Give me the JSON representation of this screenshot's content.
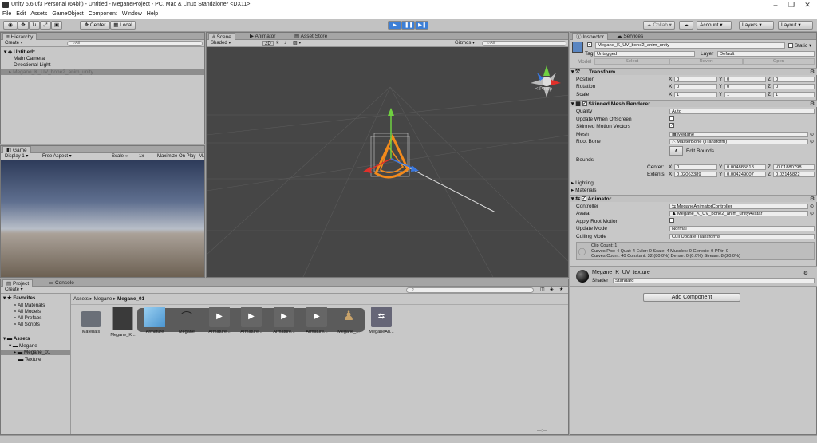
{
  "window": {
    "title": "Unity 5.6.0f3 Personal (64bit) - Untitled - MeganeProject - PC, Mac & Linux Standalone* <DX11>"
  },
  "menu": [
    "File",
    "Edit",
    "Assets",
    "GameObject",
    "Component",
    "Window",
    "Help"
  ],
  "toolbar": {
    "center": "Center",
    "local": "Local",
    "collab": "Collab",
    "account": "Account",
    "layers": "Layers",
    "layout": "Layout"
  },
  "hierarchy": {
    "tab": "Hierarchy",
    "create": "Create",
    "search": "All",
    "scene": "Untitled*",
    "items": [
      "Main Camera",
      "Directional Light",
      "Megane_K_UV_bone2_anim_unity"
    ]
  },
  "scene": {
    "tabs": [
      "Scene",
      "Animator",
      "Asset Store"
    ],
    "shaded": "Shaded",
    "mode2d": "2D",
    "gizmos": "Gizmos",
    "search": "All",
    "persp": "< Persp"
  },
  "game": {
    "tab": "Game",
    "display": "Display 1",
    "aspect": "Free Aspect",
    "scale": "Scale",
    "scale_val": "1x",
    "maximize": "Maximize On Play",
    "mute": "Mu"
  },
  "project": {
    "tabs": [
      "Project",
      "Console"
    ],
    "create": "Create",
    "favorites": {
      "label": "Favorites",
      "items": [
        "All Materials",
        "All Models",
        "All Prefabs",
        "All Scripts"
      ]
    },
    "assets": {
      "label": "Assets",
      "megane": "Megane",
      "megane01": "Megane_01",
      "texture": "Texture"
    },
    "breadcrumb": [
      "Assets",
      "Megane",
      "Megane_01"
    ],
    "files": [
      "Materials",
      "Megane_K...",
      "Armature",
      "Megane",
      "Armature...",
      "Armature...",
      "Armature...",
      "Armature...",
      "Megane_...",
      "MeganeAn..."
    ]
  },
  "inspector": {
    "tabs": [
      "Inspector",
      "Services"
    ],
    "object_name": "Megane_K_UV_bone2_anim_unity",
    "static": "Static",
    "tag_label": "Tag",
    "tag": "Untagged",
    "layer_label": "Layer",
    "layer": "Default",
    "model": "Model",
    "select": "Select",
    "revert": "Revert",
    "open": "Open",
    "transform": {
      "title": "Transform",
      "rows": [
        {
          "label": "Position",
          "x": "0",
          "y": "0",
          "z": "0"
        },
        {
          "label": "Rotation",
          "x": "0",
          "y": "0",
          "z": "0"
        },
        {
          "label": "Scale",
          "x": "1",
          "y": "1",
          "z": "1"
        }
      ]
    },
    "smr": {
      "title": "Skinned Mesh Renderer",
      "quality_label": "Quality",
      "quality": "Auto",
      "update_offscreen": "Update When Offscreen",
      "skinned_motion": "Skinned Motion Vectors",
      "mesh_label": "Mesh",
      "mesh": "Megane",
      "root_bone_label": "Root Bone",
      "root_bone": "MasterBone (Transform)",
      "edit_bounds": "Edit Bounds",
      "bounds": "Bounds",
      "center_label": "Center:",
      "center": {
        "x": "0",
        "y": "0.004885818",
        "z": "-0.01880798"
      },
      "extents_label": "Extents:",
      "extents": {
        "x": "0.02063389",
        "y": "0.004249007",
        "z": "0.02145822"
      },
      "lighting": "Lighting",
      "materials": "Materials"
    },
    "animator": {
      "title": "Animator",
      "controller_label": "Controller",
      "controller": "MeganeAnimatorController",
      "avatar_label": "Avatar",
      "avatar": "Megane_K_UV_bone2_anim_unityAvatar",
      "root_motion": "Apply Root Motion",
      "update_mode_label": "Update Mode",
      "update_mode": "Normal",
      "culling_label": "Culling Mode",
      "culling": "Cull Update Transforms",
      "info": [
        "Clip Count: 1",
        "Curves Pos: 4 Quat: 4 Euler: 0 Scale: 4 Muscles: 0 Generic: 0 PPtr: 0",
        "Curves Count: 40 Constant: 32 (80.0%) Dense: 0 (0.0%) Stream: 8 (20.0%)"
      ]
    },
    "material": {
      "name": "Megane_K_UV_texture",
      "shader_label": "Shader",
      "shader": "Standard"
    },
    "add_component": "Add Component"
  },
  "colors": {
    "scene_bg": "#464646",
    "selection": "#8d8d8d",
    "play_blue": "#3d7fd6"
  }
}
